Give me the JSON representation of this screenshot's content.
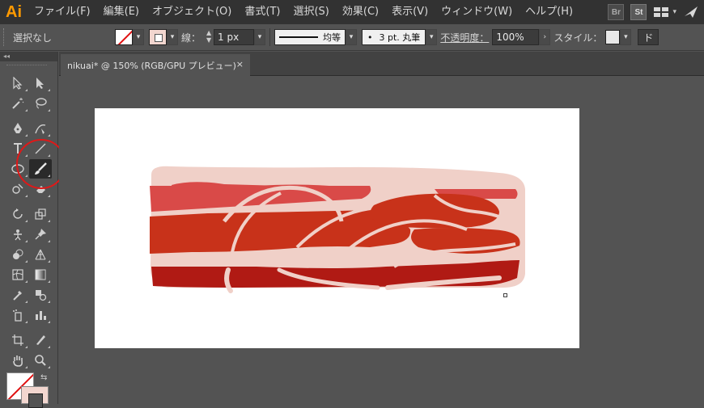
{
  "app": {
    "logo": "Ai"
  },
  "menu": [
    "ファイル(F)",
    "編集(E)",
    "オブジェクト(O)",
    "書式(T)",
    "選択(S)",
    "効果(C)",
    "表示(V)",
    "ウィンドウ(W)",
    "ヘルプ(H)"
  ],
  "menu_right": {
    "bridge": "Br",
    "stock": "St"
  },
  "control": {
    "selection": "選択なし",
    "stroke_label": "線：",
    "stroke_weight": "1 px",
    "profile": "均等",
    "brush_dot": "•",
    "brush": "3 pt. 丸筆",
    "opacity_label": "不透明度：",
    "opacity": "100%",
    "style_label": "スタイル：",
    "doc_button": "ド"
  },
  "panel": {
    "collapse": "◂◂"
  },
  "document": {
    "tab": "nikuai* @ 150% (RGB/GPU プレビュー)",
    "close": "×"
  },
  "colors": {
    "fill": "none",
    "stroke": "#f2d6cf",
    "highlight_circle": "#e01818",
    "meat_light": "#d94a48",
    "meat_mid": "#c8321a",
    "meat_dark": "#b01a14",
    "fat": "#f0d0c8"
  },
  "tools": [
    [
      "selection-tool",
      "direct-selection-tool"
    ],
    [
      "magic-wand-tool",
      "lasso-tool"
    ],
    [
      "pen-tool",
      "curvature-tool"
    ],
    [
      "type-tool",
      "line-segment-tool"
    ],
    [
      "ellipse-tool",
      "paintbrush-tool"
    ],
    [
      "shaper-tool",
      "eraser-tool"
    ],
    [
      "rotate-tool",
      "scale-tool"
    ],
    [
      "puppet-warp-tool",
      "pin-tool"
    ],
    [
      "shape-builder-tool",
      "perspective-grid-tool"
    ],
    [
      "mesh-tool",
      "gradient-tool"
    ],
    [
      "eyedropper-tool",
      "blend-tool"
    ],
    [
      "symbol-sprayer-tool",
      "column-graph-tool"
    ],
    [
      "artboard-tool",
      "slice-tool"
    ],
    [
      "hand-tool",
      "zoom-tool"
    ]
  ]
}
